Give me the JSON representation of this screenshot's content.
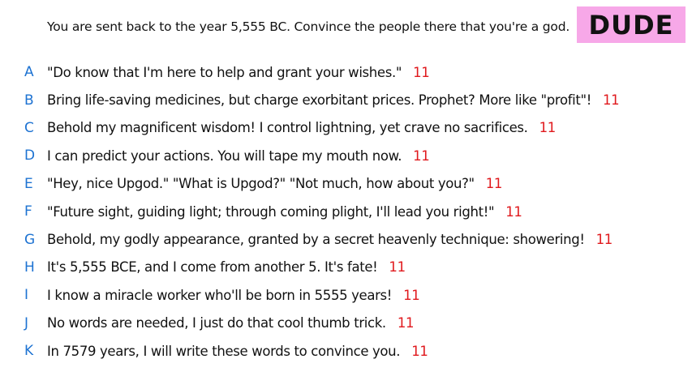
{
  "prompt": "You are sent back to the year 5,555 BC. Convince the people there that you're a god.",
  "badge": "DUDE",
  "colors": {
    "letter": "#1e73d2",
    "score": "#e0191d",
    "badge_bg": "#f7a8e8"
  },
  "answers": [
    {
      "letter": "A",
      "text": "\"Do know that I'm here to help and grant your wishes.\"",
      "score": "11"
    },
    {
      "letter": "B",
      "text": "Bring life-saving medicines, but charge exorbitant prices. Prophet? More like \"profit\"!",
      "score": "11"
    },
    {
      "letter": "C",
      "text": "Behold my magnificent wisdom! I control lightning, yet crave no sacrifices.",
      "score": "11"
    },
    {
      "letter": "D",
      "text": "I can predict your actions. You will tape my mouth now.",
      "score": "11"
    },
    {
      "letter": "E",
      "text": "\"Hey, nice Upgod.\" \"What is Upgod?\" \"Not much, how about you?\"",
      "score": "11"
    },
    {
      "letter": "F",
      "text": "\"Future sight, guiding light; through coming plight, I'll lead you right!\"",
      "score": "11"
    },
    {
      "letter": "G",
      "text": "Behold, my godly appearance, granted by a secret heavenly technique: showering!",
      "score": "11"
    },
    {
      "letter": "H",
      "text": "It's 5,555 BCE, and I come from another 5. It's fate!",
      "score": "11"
    },
    {
      "letter": "I",
      "text": "I know a miracle worker who'll be born in 5555 years!",
      "score": "11"
    },
    {
      "letter": "J",
      "text": "No words are needed, I just do that cool thumb trick.",
      "score": "11"
    },
    {
      "letter": "K",
      "text": "In 7579 years, I will write these words to convince you.",
      "score": "11"
    }
  ]
}
